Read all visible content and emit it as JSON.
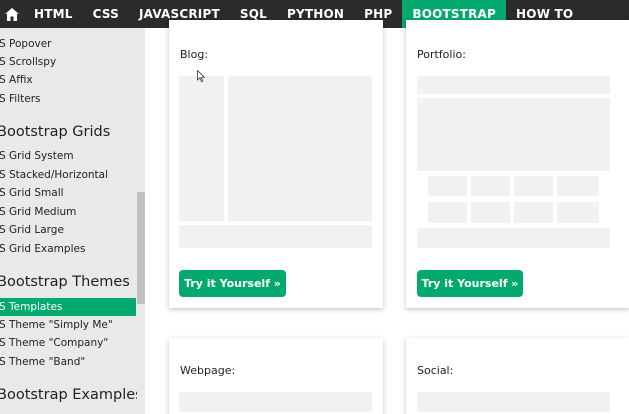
{
  "topnav": {
    "home_icon": "home-icon",
    "items": [
      "HTML",
      "CSS",
      "JAVASCRIPT",
      "SQL",
      "PYTHON",
      "PHP",
      "BOOTSTRAP",
      "HOW TO"
    ],
    "active": "BOOTSTRAP"
  },
  "sidebar": {
    "links_top": [
      "BS Popover",
      "BS Scrollspy",
      "BS Affix",
      "BS Filters"
    ],
    "heading_grids": "Bootstrap Grids",
    "links_grids": [
      "BS Grid System",
      "BS Stacked/Horizontal",
      "BS Grid Small",
      "BS Grid Medium",
      "BS Grid Large",
      "BS Grid Examples"
    ],
    "heading_themes": "Bootstrap Themes",
    "links_themes": [
      "BS Templates",
      "BS Theme \"Simply Me\"",
      "BS Theme \"Company\"",
      "BS Theme \"Band\""
    ],
    "heading_examples": "Bootstrap Examples"
  },
  "cards": {
    "blog": {
      "title": "Blog:",
      "button": "Try it Yourself »"
    },
    "portfolio": {
      "title": "Portfolio:",
      "button": "Try it Yourself »"
    },
    "webpage": {
      "title": "Webpage:"
    },
    "social": {
      "title": "Social:"
    }
  },
  "colors": {
    "accent": "#04AA6D",
    "nav": "#2b2b2b",
    "sidebar": "#e7e9eb",
    "placeholder": "#f1f1f1"
  }
}
